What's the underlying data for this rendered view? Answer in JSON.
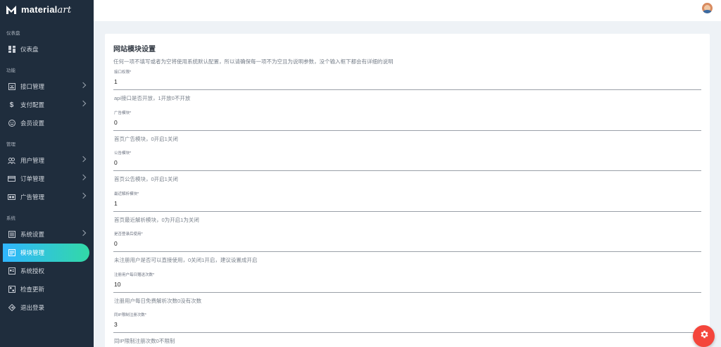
{
  "brand": {
    "name": "material",
    "suffix": "art"
  },
  "sidebar": {
    "sections": [
      {
        "title": "仪表盘",
        "items": [
          {
            "label": "仪表盘",
            "icon": "dashboard-icon",
            "chevron": false
          }
        ]
      },
      {
        "title": "功能",
        "items": [
          {
            "label": "接口管理",
            "icon": "api-icon",
            "chevron": true
          },
          {
            "label": "支付配置",
            "icon": "dollar-icon",
            "chevron": true
          },
          {
            "label": "会员设置",
            "icon": "smile-icon",
            "chevron": false
          }
        ]
      },
      {
        "title": "管理",
        "items": [
          {
            "label": "用户管理",
            "icon": "users-icon",
            "chevron": true
          },
          {
            "label": "订单管理",
            "icon": "card-icon",
            "chevron": true
          },
          {
            "label": "广告管理",
            "icon": "ad-icon",
            "chevron": true
          }
        ]
      },
      {
        "title": "系统",
        "items": [
          {
            "label": "系统设置",
            "icon": "list-icon",
            "chevron": true
          },
          {
            "label": "模块管理",
            "icon": "module-icon",
            "chevron": false,
            "active": true
          },
          {
            "label": "系统授权",
            "icon": "license-icon",
            "chevron": false
          },
          {
            "label": "检查更新",
            "icon": "update-icon",
            "chevron": false
          },
          {
            "label": "退出登录",
            "icon": "logout-icon",
            "chevron": false
          }
        ]
      }
    ]
  },
  "card": {
    "title": "网站模块设置",
    "subtitle": "任何一项不填写或者为空将使用系统默认配置，所以请确保每一项不为空且为说明参数，没个输入框下都会有详细的说明",
    "fields": [
      {
        "label": "接口权限*",
        "value": "1",
        "help": "api接口是否开放，1开放0不开放"
      },
      {
        "label": "广告模块*",
        "value": "0",
        "help": "首页广告模块，0开启1关闭"
      },
      {
        "label": "公告模块*",
        "value": "0",
        "help": "首页公告模块，0开启1关闭"
      },
      {
        "label": "最近解析模块*",
        "value": "1",
        "help": "首页最近解析模块，0为开启1为关闭"
      },
      {
        "label": "是否登录后使用*",
        "value": "0",
        "help": "未注册用户是否可以直接使用，0关闭1开启，建议设置成开启"
      },
      {
        "label": "注册用户每日赠送次数*",
        "value": "10",
        "help": "注册用户每日免费解析次数0没有次数"
      },
      {
        "label": "同IP限制注册次数*",
        "value": "3",
        "help": "同IP限制注册次数0不限制"
      }
    ]
  },
  "colors": {
    "sidebar": "#1f2d3d",
    "accent_start": "#30b5ff",
    "accent_end": "#32d9a7",
    "fab": "#f4463c"
  },
  "fab": {
    "icon": "gear-icon"
  }
}
